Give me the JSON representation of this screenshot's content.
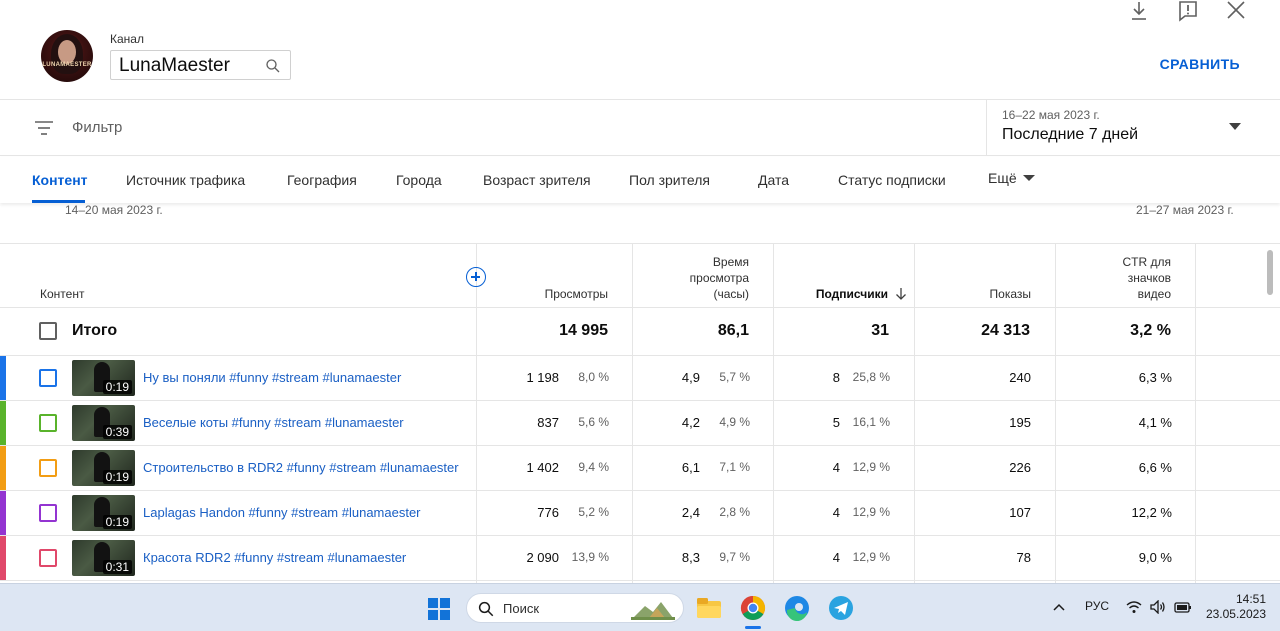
{
  "header": {
    "channel_label": "Канал",
    "channel_name": "LunaMaester",
    "avatar_text": "LUNAMAESTER",
    "compare_label": "СРАВНИТЬ"
  },
  "filter": {
    "placeholder": "Фильтр",
    "date_range": "16–22 мая 2023 г.",
    "date_period": "Последние 7 дней"
  },
  "tabs": [
    {
      "label": "Контент",
      "active": true
    },
    {
      "label": "Источник трафика"
    },
    {
      "label": "География"
    },
    {
      "label": "Города"
    },
    {
      "label": "Возраст зрителя"
    },
    {
      "label": "Пол зрителя"
    },
    {
      "label": "Дата"
    },
    {
      "label": "Статус подписки"
    },
    {
      "label": "Ещё"
    }
  ],
  "periods": {
    "left": "14–20 мая 2023 г.",
    "right": "21–27 мая 2023 г."
  },
  "table": {
    "headers": {
      "content": "Контент",
      "views": "Просмотры",
      "watch_time": [
        "Время",
        "просмотра",
        "(часы)"
      ],
      "subscribers": "Подписчики",
      "impressions": "Показы",
      "ctr": [
        "CTR для",
        "значков",
        "видео"
      ]
    },
    "total": {
      "label": "Итого",
      "views": "14 995",
      "watch_time": "86,1",
      "subscribers": "31",
      "impressions": "24 313",
      "ctr": "3,2 %"
    },
    "rows": [
      {
        "color": "#1a73e8",
        "duration": "0:19",
        "title": "Ну вы поняли #funny #stream #lunamaester",
        "views": "1 198",
        "views_pct": "8,0 %",
        "watch": "4,9",
        "watch_pct": "5,7 %",
        "subs": "8",
        "subs_pct": "25,8 %",
        "impressions": "240",
        "ctr": "6,3 %"
      },
      {
        "color": "#59b32b",
        "duration": "0:39",
        "title": "Веселые коты #funny #stream #lunamaester",
        "views": "837",
        "views_pct": "5,6 %",
        "watch": "4,2",
        "watch_pct": "4,9 %",
        "subs": "5",
        "subs_pct": "16,1 %",
        "impressions": "195",
        "ctr": "4,1 %"
      },
      {
        "color": "#f29d14",
        "duration": "0:19",
        "title": "Строительство в RDR2 #funny #stream #lunamaester",
        "views": "1 402",
        "views_pct": "9,4 %",
        "watch": "6,1",
        "watch_pct": "7,1 %",
        "subs": "4",
        "subs_pct": "12,9 %",
        "impressions": "226",
        "ctr": "6,6 %"
      },
      {
        "color": "#9334d1",
        "duration": "0:19",
        "title": "Laplagas Handon #funny #stream #lunamaester",
        "views": "776",
        "views_pct": "5,2 %",
        "watch": "2,4",
        "watch_pct": "2,8 %",
        "subs": "4",
        "subs_pct": "12,9 %",
        "impressions": "107",
        "ctr": "12,2 %"
      },
      {
        "color": "#e0486a",
        "duration": "0:31",
        "title": "Красота RDR2 #funny #stream #lunamaester",
        "views": "2 090",
        "views_pct": "13,9 %",
        "watch": "8,3",
        "watch_pct": "9,7 %",
        "subs": "4",
        "subs_pct": "12,9 %",
        "impressions": "78",
        "ctr": "9,0 %"
      }
    ]
  },
  "taskbar": {
    "search_placeholder": "Поиск",
    "language": "РУС",
    "time": "14:51",
    "date": "23.05.2023"
  },
  "icons": {
    "download": "download-icon",
    "feedback": "feedback-icon",
    "close": "close-icon",
    "search": "search-icon",
    "filter": "filter-icon",
    "sort": "arrow-down-icon"
  },
  "colors": {
    "accent": "#065fd4",
    "link": "#1a5fc4",
    "taskbar": "#dde6f3"
  }
}
